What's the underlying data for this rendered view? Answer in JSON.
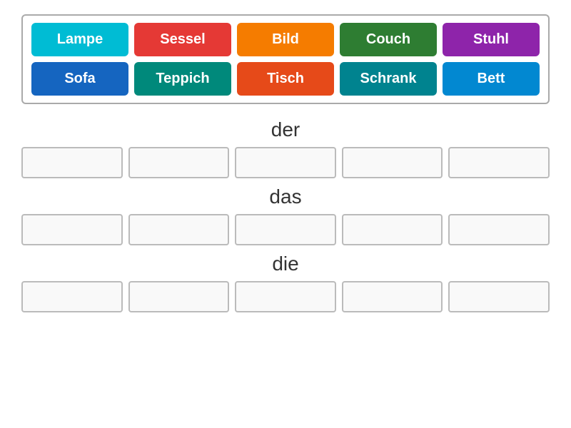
{
  "wordBank": {
    "tiles": [
      {
        "id": "lampe",
        "label": "Lampe",
        "colorClass": "tile-cyan"
      },
      {
        "id": "sessel",
        "label": "Sessel",
        "colorClass": "tile-red"
      },
      {
        "id": "bild",
        "label": "Bild",
        "colorClass": "tile-orange"
      },
      {
        "id": "couch",
        "label": "Couch",
        "colorClass": "tile-green"
      },
      {
        "id": "stuhl",
        "label": "Stuhl",
        "colorClass": "tile-purple"
      },
      {
        "id": "sofa",
        "label": "Sofa",
        "colorClass": "tile-blue"
      },
      {
        "id": "teppich",
        "label": "Teppich",
        "colorClass": "tile-teal"
      },
      {
        "id": "tisch",
        "label": "Tisch",
        "colorClass": "tile-deeporange"
      },
      {
        "id": "schrank",
        "label": "Schrank",
        "colorClass": "tile-teal2"
      },
      {
        "id": "bett",
        "label": "Bett",
        "colorClass": "tile-lightblue"
      }
    ]
  },
  "sections": [
    {
      "id": "der",
      "label": "der"
    },
    {
      "id": "das",
      "label": "das"
    },
    {
      "id": "die",
      "label": "die"
    }
  ],
  "dropBoxCount": 5
}
